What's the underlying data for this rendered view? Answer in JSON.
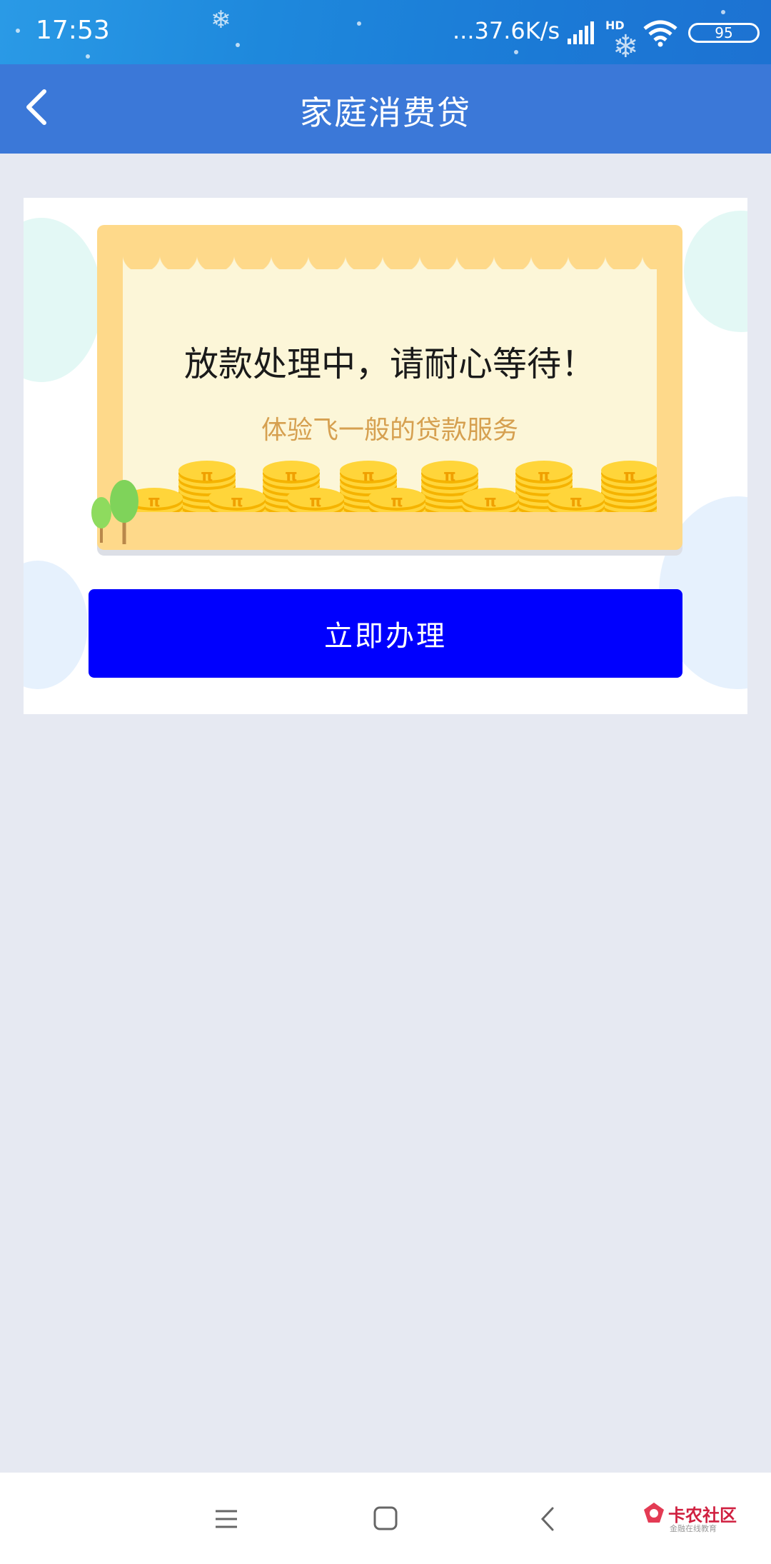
{
  "status_bar": {
    "time": "17:53",
    "network_speed": "...37.6K/s",
    "hd_label": "HD",
    "battery": "95"
  },
  "header": {
    "title": "家庭消费贷",
    "back_icon": "chevron-left-icon"
  },
  "banner": {
    "headline": "放款处理中，请耐心等待！",
    "subtitle": "体验飞一般的贷款服务",
    "coin_symbol": "π"
  },
  "actions": {
    "apply_label": "立即办理"
  },
  "nav_bar": {
    "icons": [
      "menu-icon",
      "home-square-icon",
      "back-chevron-icon"
    ]
  },
  "watermark": {
    "name": "卡农社区",
    "tagline": "金融在线教育"
  },
  "colors": {
    "header": "#3b78d8",
    "button": "#0000fe",
    "background": "#e6e9f2",
    "banner": "#fed98a"
  }
}
